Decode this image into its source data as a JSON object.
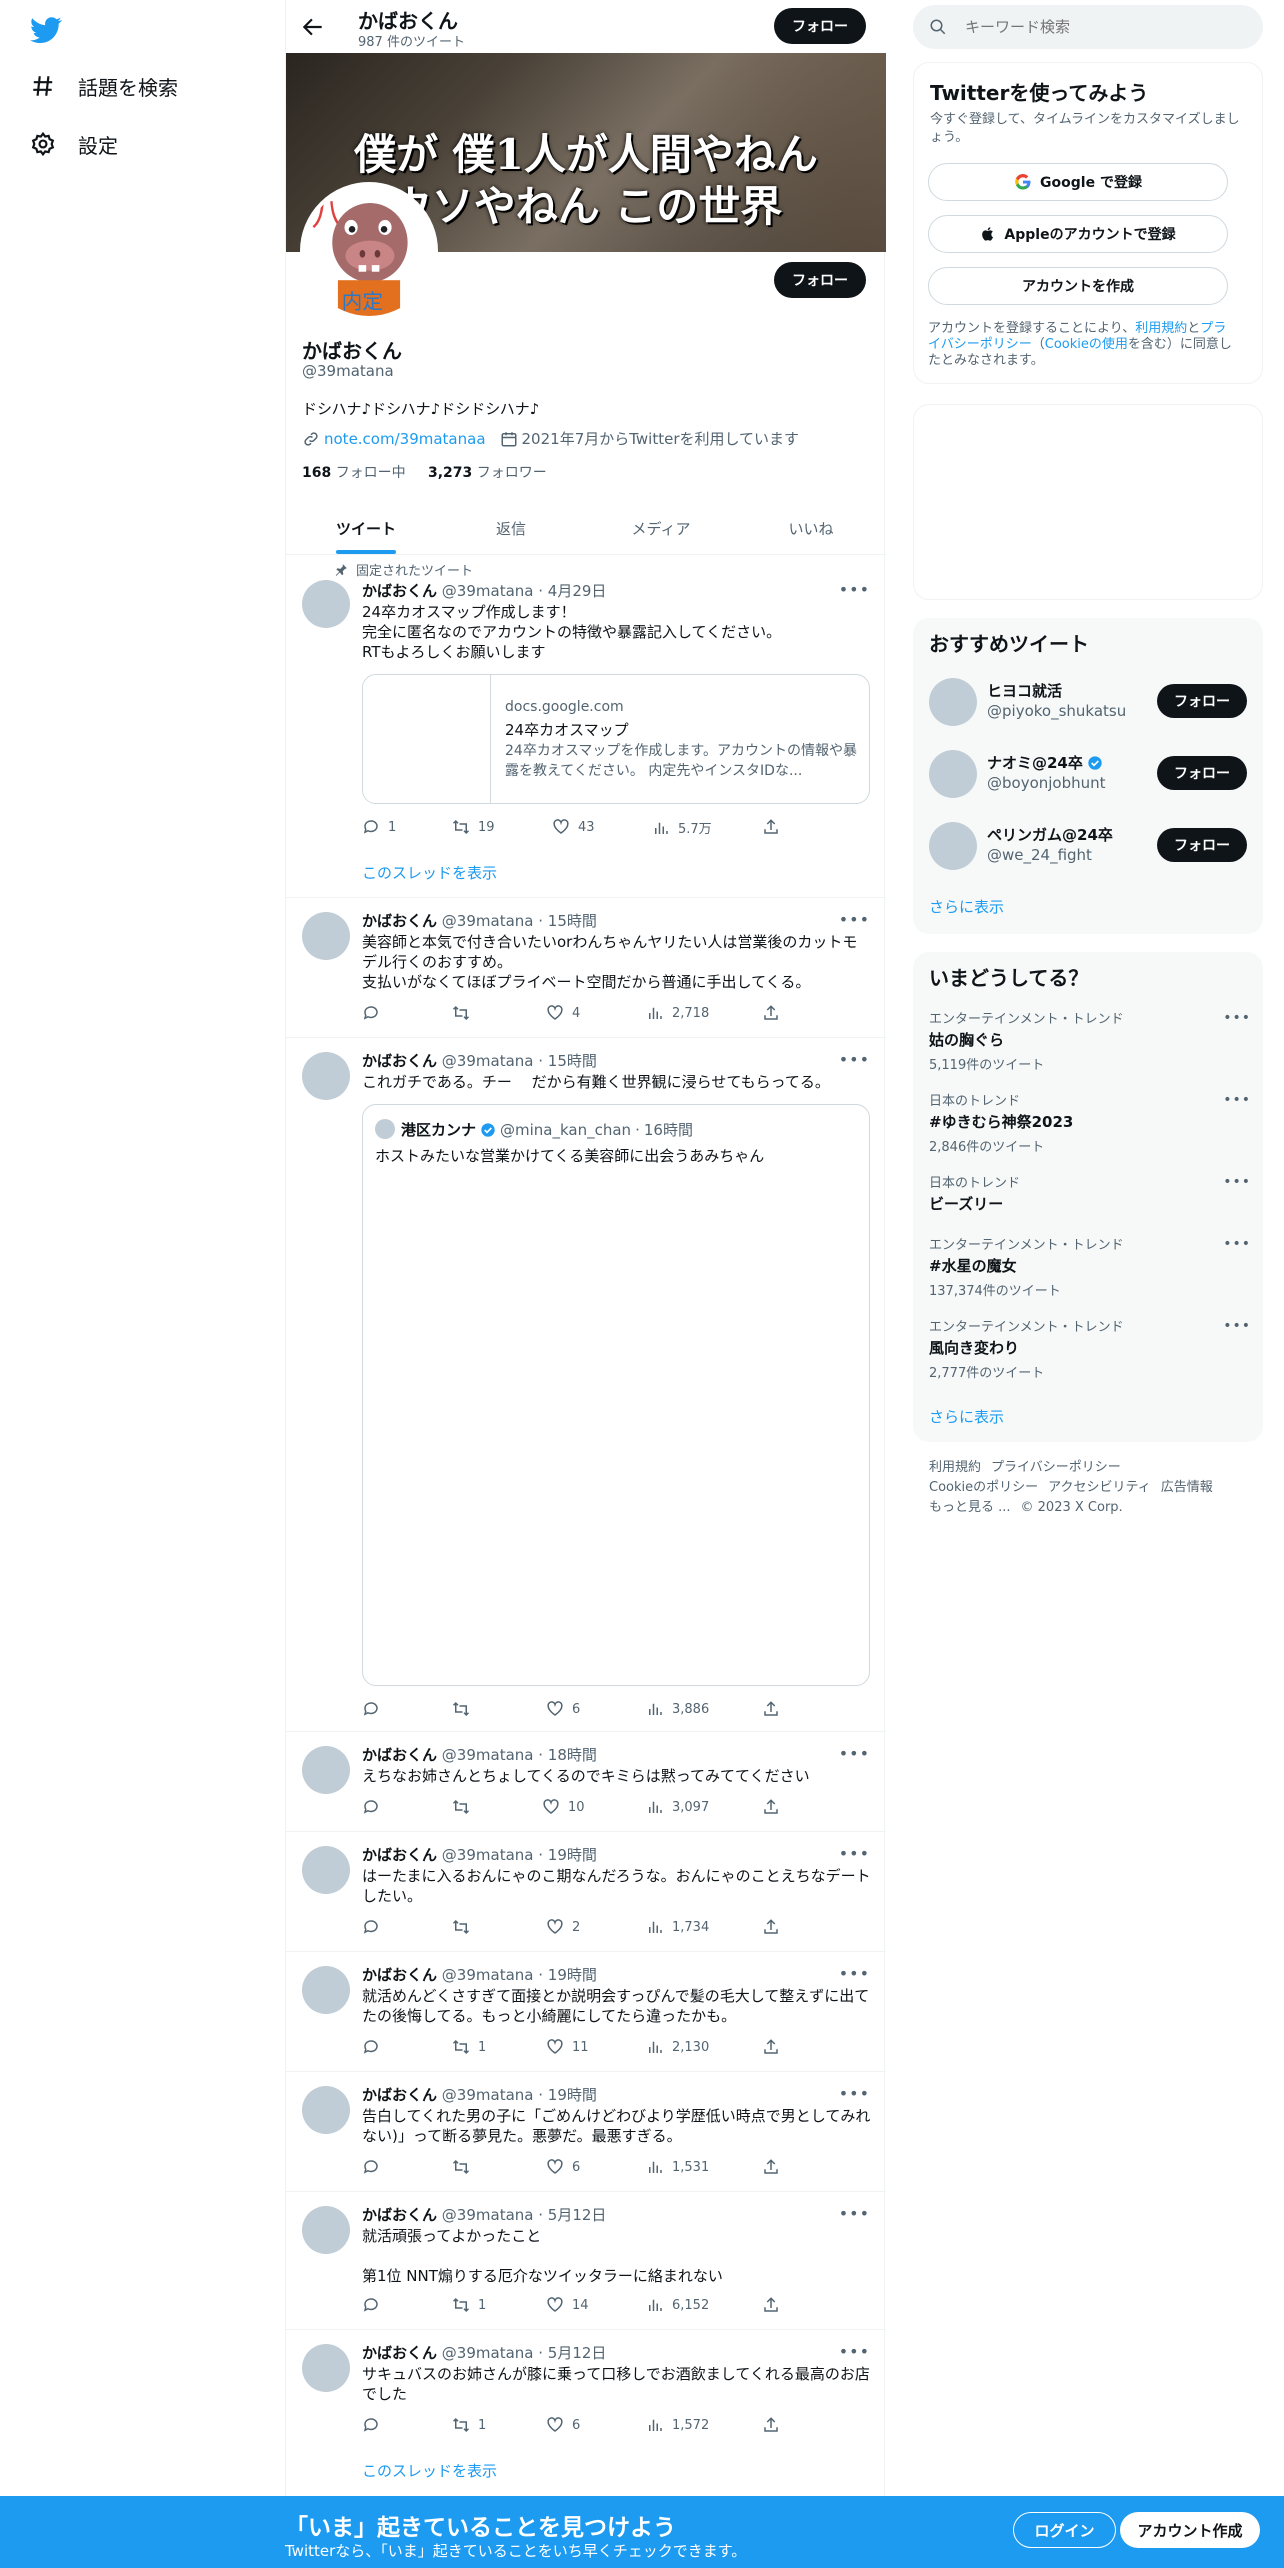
{
  "sidebar": {
    "items": [
      {
        "label": "話題を検索"
      },
      {
        "label": "設定"
      }
    ]
  },
  "header": {
    "name": "かばおくん",
    "tweet_count": "987 件のツイート",
    "follow_label": "フォロー"
  },
  "banner": {
    "line1": "僕が 僕1人が人間やねん",
    "line2": "ウソやねん この世界"
  },
  "profile": {
    "name": "かばおくん",
    "handle": "@39matana",
    "bio": "ドシハナ♪ドシハナ♪ドシドシハナ♪",
    "link": "note.com/39matanaa",
    "joined": "2021年7月からTwitterを利用しています",
    "following_count": "168",
    "following_label": "フォロー中",
    "followers_count": "3,273",
    "followers_label": "フォロワー",
    "follow_label": "フォロー"
  },
  "tabs": [
    {
      "label": "ツイート"
    },
    {
      "label": "返信"
    },
    {
      "label": "メディア"
    },
    {
      "label": "いいね"
    }
  ],
  "pinned_label": "固定されたツイート",
  "show_thread": "このスレッドを表示",
  "tweets": [
    {
      "name": "かばおくん",
      "handle": "@39matana",
      "time": "4月29日",
      "text": "24卒カオスマップ作成します！\n完全に匿名なのでアカウントの特徴や暴露記入してください。\nRTもよろしくお願いします",
      "card": {
        "domain": "docs.google.com",
        "title": "24卒カオスマップ",
        "desc": "24卒カオスマップを作成します。アカウントの情報や暴露を教えてください。 内定先やインスタIDな..."
      },
      "replies": "1",
      "retweets": "19",
      "likes": "43",
      "views": "5.7万"
    },
    {
      "name": "かばおくん",
      "handle": "@39matana",
      "time": "15時間",
      "text": "美容師と本気で付き合いたいorわんちゃんヤリたい人は営業後のカットモデル行くのおすすめ。\n支払いがなくてほぼプライベート空間だから普通に手出してくる。",
      "replies": "",
      "retweets": "",
      "likes": "4",
      "views": "2,718"
    },
    {
      "name": "かばおくん",
      "handle": "@39matana",
      "time": "15時間",
      "text": "これガチである。チー　 だから有難く世界観に浸らせてもらってる。",
      "quote": {
        "name": "港区カンナ",
        "handle": "@mina_kan_chan",
        "time": "16時間",
        "text": "ホストみたいな営業かけてくる美容師に出会うあみちゃん"
      },
      "replies": "",
      "retweets": "",
      "likes": "6",
      "views": "3,886"
    },
    {
      "name": "かばおくん",
      "handle": "@39matana",
      "time": "18時間",
      "text": "えちなお姉さんとちょしてくるのでキミらは黙ってみててください",
      "replies": "",
      "retweets": "",
      "likes": "10",
      "views": "3,097"
    },
    {
      "name": "かばおくん",
      "handle": "@39matana",
      "time": "19時間",
      "text": "はーたまに入るおんにゃのこ期なんだろうな。おんにゃのことえちなデートしたい。",
      "replies": "",
      "retweets": "",
      "likes": "2",
      "views": "1,734"
    },
    {
      "name": "かばおくん",
      "handle": "@39matana",
      "time": "19時間",
      "text": "就活めんどくさすぎて面接とか説明会すっぴんで髪の毛大して整えずに出てたの後悔してる。もっと小綺麗にしてたら違ったかも。",
      "replies": "",
      "retweets": "1",
      "likes": "11",
      "views": "2,130"
    },
    {
      "name": "かばおくん",
      "handle": "@39matana",
      "time": "19時間",
      "text": "告白してくれた男の子に「ごめんけどわびより学歴低い時点で男としてみれない)」って断る夢見た。悪夢だ。最悪すぎる。",
      "replies": "",
      "retweets": "",
      "likes": "6",
      "views": "1,531"
    },
    {
      "name": "かばおくん",
      "handle": "@39matana",
      "time": "5月12日",
      "text": "就活頑張ってよかったこと\n\n第1位 NNT煽りする厄介なツイッタラーに絡まれない",
      "replies": "",
      "retweets": "1",
      "likes": "14",
      "views": "6,152"
    },
    {
      "name": "かばおくん",
      "handle": "@39matana",
      "time": "5月12日",
      "text": "サキュバスのお姉さんが膝に乗って口移しでお酒飲ましてくれる最高のお店でした",
      "replies": "",
      "retweets": "1",
      "likes": "6",
      "views": "1,572"
    }
  ],
  "search": {
    "placeholder": "キーワード検索"
  },
  "signup_panel": {
    "title": "Twitterを使ってみよう",
    "subtitle": "今すぐ登録して、タイムラインをカスタマイズしましょう。",
    "google": "Google で登録",
    "apple": "Appleのアカウントで登録",
    "create": "アカウントを作成",
    "legal_pre": "アカウントを登録することにより、",
    "legal_terms": "利用規約",
    "legal_and": "と",
    "legal_privacy": "プライバシーポリシー",
    "legal_paren": "（",
    "legal_cookie": "Cookieの使用",
    "legal_post": "を含む）に同意したとみなされます。"
  },
  "recommend": {
    "title": "おすすめツイート",
    "users": [
      {
        "name": "ヒヨコ就活",
        "handle": "@piyoko_shukatsu",
        "verified": false
      },
      {
        "name": "ナオミ@24卒",
        "handle": "@boyonjobhunt",
        "verified": true
      },
      {
        "name": "ペリンガム@24卒",
        "handle": "@we_24_fight",
        "verified": false
      }
    ],
    "follow_label": "フォロー",
    "more": "さらに表示"
  },
  "trends": {
    "title": "いまどうしてる？",
    "items": [
      {
        "category": "エンターテインメント・トレンド",
        "name": "姑の胸ぐら",
        "count": "5,119件のツイート"
      },
      {
        "category": "日本のトレンド",
        "name": "#ゆきむら神祭2023",
        "count": "2,846件のツイート"
      },
      {
        "category": "日本のトレンド",
        "name": "ビーズリー",
        "count": ""
      },
      {
        "category": "エンターテインメント・トレンド",
        "name": "#水星の魔女",
        "count": "137,374件のツイート"
      },
      {
        "category": "エンターテインメント・トレンド",
        "name": "風向き変わり",
        "count": "2,777件のツイート"
      }
    ],
    "more": "さらに表示"
  },
  "footer": {
    "links": [
      "利用規約",
      "プライバシーポリシー",
      "Cookieのポリシー",
      "アクセシビリティ",
      "広告情報",
      "もっと見る ...",
      "© 2023 X Corp."
    ]
  },
  "bottom_bar": {
    "title": "「いま」起きていることを見つけよう",
    "subtitle": "Twitterなら、「いま」起きていることをいち早くチェックできます。",
    "login": "ログイン",
    "signup": "アカウント作成"
  },
  "colors": {
    "accent": "#1d9bf0",
    "text": "#0f1419",
    "muted": "#536471",
    "border": "#eff3f4",
    "panel_bg": "#f7f9f9"
  }
}
